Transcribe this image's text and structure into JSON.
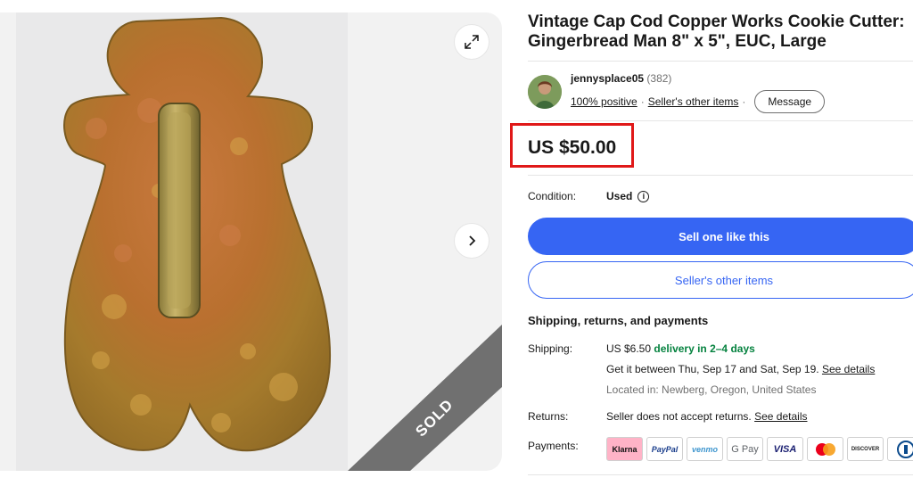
{
  "listing": {
    "title": "Vintage Cap Cod Copper Works Cookie Cutter: Gingerbread Man 8\" x 5\", EUC, Large",
    "sold_label": "SOLD",
    "price": "US $50.00"
  },
  "seller": {
    "name": "jennysplace05",
    "feedback_count": "(382)",
    "positive": "100% positive",
    "separator": "·",
    "other_items": "Seller's other items",
    "message_label": "Message"
  },
  "condition": {
    "label": "Condition:",
    "value": "Used",
    "info_icon": "i"
  },
  "actions": {
    "sell_one": "Sell one like this",
    "seller_other_items": "Seller's other items"
  },
  "shipping": {
    "heading": "Shipping, returns, and payments",
    "label": "Shipping:",
    "cost": "US $6.50",
    "delivery": "delivery in 2–4 days",
    "get_it": "Get it between Thu, Sep 17 and Sat, Sep 19.",
    "see_details": "See details",
    "location": "Located in: Newberg, Oregon, United States"
  },
  "returns": {
    "label": "Returns:",
    "text": "Seller does not accept returns.",
    "see_details": "See details"
  },
  "payments": {
    "label": "Payments:",
    "methods": [
      "Klarna",
      "PayPal",
      "venmo",
      "G Pay",
      "VISA",
      "mastercard",
      "DISCOVER",
      "diners"
    ]
  },
  "colors": {
    "primary": "#3665f3",
    "highlight": "#e01818",
    "green": "#05823f",
    "sold_band": "#707070"
  }
}
